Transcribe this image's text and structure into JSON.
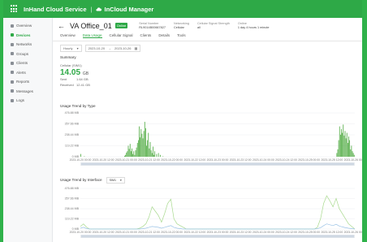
{
  "header": {
    "brand": "InHand Cloud Service",
    "product": "InCloud Manager"
  },
  "sidebar": {
    "items": [
      {
        "label": "Overview",
        "active": false
      },
      {
        "label": "Devices",
        "active": true
      },
      {
        "label": "Networks",
        "active": false
      },
      {
        "label": "Groups",
        "active": false
      },
      {
        "label": "Clients",
        "active": false
      },
      {
        "label": "Alerts",
        "active": false
      },
      {
        "label": "Reports",
        "active": false
      },
      {
        "label": "Messages",
        "active": false
      },
      {
        "label": "Logs",
        "active": false
      }
    ]
  },
  "device": {
    "name": "VA Office_01",
    "status": "Online",
    "meta": [
      {
        "label": "Serial Number",
        "value": "RL9014B00667827"
      },
      {
        "label": "Networking",
        "value": "Cellular"
      },
      {
        "label": "Cellular Signal Strength",
        "value": "all"
      },
      {
        "label": "Online",
        "value": "1 day 4 hours 1 minute"
      }
    ]
  },
  "tabs": [
    "Overview",
    "Data Usage",
    "Cellular Signal",
    "Clients",
    "Details",
    "Tools"
  ],
  "active_tab": "Data Usage",
  "filters": {
    "period": "Hourly",
    "start": "2023-10-20",
    "end": "2023-10-26"
  },
  "summary": {
    "title": "Summary",
    "subtitle": "Cellular (SIM1)",
    "total": "14.05",
    "total_unit": "GB",
    "sent_label": "Sent",
    "sent": "1.64 GB",
    "received_label": "Received",
    "received": "12.41 GB"
  },
  "chart1_title": "Usage Trend by Type",
  "chart2_title": "Usage Trend by Interface",
  "chart2_select": "SIM1",
  "colors": {
    "accent": "#2ea947",
    "bar": "#4aa83c",
    "line": "#a8d98e",
    "line2": "#9bc3e6"
  },
  "chart_data": [
    {
      "type": "bar",
      "title": "Usage Trend by Type",
      "ylabels": [
        "476.88 MB",
        "357.66 MB",
        "238.44 MB",
        "119.22 MB",
        "0 MB"
      ],
      "xlabels": [
        "2023-10-20 00:00",
        "2023-10-20 12:00",
        "2023-10-21 00:00",
        "2023-10-21 12:00",
        "2023-10-22 00:00",
        "2023-10-22 12:00",
        "2023-10-23 00:00",
        "2023-10-23 12:00",
        "2023-10-24 00:00",
        "2023-10-24 12:00",
        "2023-10-25 00:00",
        "2023-10-25 12:00",
        "2023-10-26 00:00"
      ],
      "ylim": [
        0,
        476.88
      ],
      "values": [
        30,
        0,
        0,
        0,
        5,
        0,
        0,
        0,
        0,
        0,
        0,
        0,
        0,
        0,
        0,
        0,
        0,
        0,
        0,
        0,
        0,
        0,
        0,
        0,
        0,
        0,
        0,
        0,
        0,
        0,
        0,
        0,
        0,
        0,
        0,
        0,
        0,
        0,
        0,
        0,
        0,
        0,
        0,
        0,
        0,
        0,
        0,
        0,
        10,
        20,
        45,
        60,
        120,
        85,
        140,
        60,
        90,
        30,
        60,
        20,
        70,
        100,
        150,
        180,
        330,
        210,
        300,
        250,
        200,
        280,
        380,
        310,
        120,
        180,
        260,
        90,
        160,
        70,
        40,
        110,
        20,
        60,
        0,
        30,
        0,
        40,
        0,
        20,
        0,
        0,
        5,
        0,
        0,
        0,
        0,
        0,
        0,
        0,
        0,
        0,
        0,
        0,
        0,
        0,
        0,
        0,
        0,
        0,
        0,
        0,
        0,
        0,
        0,
        0,
        0,
        0,
        0,
        0,
        0,
        0,
        0,
        0,
        0,
        0,
        0,
        0,
        0,
        0,
        0,
        0,
        0,
        0,
        0,
        0,
        0,
        0,
        0,
        0,
        0,
        0,
        0,
        0,
        0,
        0,
        0,
        0,
        0,
        0,
        0,
        0,
        0,
        0,
        0,
        0,
        0,
        0,
        0,
        0,
        0,
        0,
        0,
        0,
        0,
        0,
        0,
        0,
        0,
        0,
        0,
        0,
        0,
        0,
        0,
        0,
        0,
        0,
        0,
        0,
        0,
        0,
        0,
        0,
        0,
        0,
        0,
        0,
        0,
        0,
        0,
        0,
        0,
        0,
        0,
        0,
        0,
        0,
        0,
        0,
        0,
        0,
        0,
        0,
        0,
        0,
        0,
        0,
        0,
        0,
        0,
        0,
        0,
        0,
        0,
        0,
        0,
        0,
        0,
        0,
        0,
        0,
        0,
        0,
        0,
        0,
        0,
        0,
        0,
        0,
        0,
        0,
        0,
        0,
        0,
        0,
        0,
        0,
        0,
        0,
        0,
        0,
        0,
        0,
        0,
        0,
        0,
        0,
        0,
        0,
        0,
        0,
        0,
        0,
        0,
        0,
        0,
        0,
        0,
        0,
        0,
        0,
        0,
        0,
        0,
        0,
        0,
        0,
        0,
        0,
        0,
        0,
        0,
        0,
        0,
        0,
        0,
        0,
        0,
        0,
        0,
        0,
        40,
        80,
        180,
        330,
        240,
        300,
        260,
        350,
        230,
        280,
        200,
        260,
        150,
        220,
        180,
        80,
        120,
        60,
        40,
        20
      ]
    },
    {
      "type": "line",
      "title": "Usage Trend by Interface",
      "ylabels": [
        "476.88 MB",
        "357.66 MB",
        "238.44 MB",
        "119.22 MB",
        "0 MB"
      ],
      "xlabels": [
        "2023-10-20 00:00",
        "2023-10-20 12:00",
        "2023-10-21 00:00",
        "2023-10-21 12:00",
        "2023-10-22 00:00",
        "2023-10-22 12:00",
        "2023-10-23 00:00",
        "2023-10-23 12:00",
        "2023-10-24 00:00",
        "2023-10-24 12:00",
        "2023-10-25 00:00",
        "2023-10-25 12:00",
        "2023-10-26 00:00"
      ],
      "ylim": [
        0,
        476.88
      ],
      "series": [
        {
          "name": "SIM1",
          "values": [
            30,
            60,
            20,
            0,
            0,
            0,
            0,
            0,
            0,
            0,
            0,
            0,
            0,
            0,
            0,
            0,
            0,
            0,
            0,
            10,
            30,
            60,
            140,
            260,
            210,
            160,
            80,
            180,
            300,
            350,
            120,
            60,
            40,
            20,
            0,
            0,
            0,
            0,
            0,
            0,
            0,
            0,
            0,
            0,
            0,
            0,
            0,
            0,
            0,
            0,
            0,
            0,
            0,
            0,
            0,
            0,
            0,
            0,
            0,
            0,
            0,
            0,
            0,
            0,
            0,
            0,
            0,
            0,
            0,
            0,
            0,
            0,
            0,
            0,
            0,
            0,
            20,
            120,
            300,
            390,
            330,
            260,
            360,
            240,
            180,
            120,
            60,
            30,
            0
          ]
        },
        {
          "name": "",
          "values": [
            10,
            20,
            5,
            0,
            0,
            0,
            0,
            0,
            0,
            0,
            0,
            0,
            0,
            0,
            0,
            0,
            0,
            0,
            0,
            0,
            5,
            10,
            20,
            30,
            25,
            20,
            10,
            20,
            30,
            40,
            20,
            10,
            5,
            0,
            0,
            0,
            0,
            0,
            0,
            0,
            0,
            0,
            0,
            0,
            0,
            0,
            0,
            0,
            0,
            0,
            0,
            0,
            0,
            0,
            0,
            0,
            0,
            0,
            0,
            0,
            0,
            0,
            0,
            0,
            0,
            0,
            0,
            0,
            0,
            0,
            0,
            0,
            0,
            0,
            0,
            0,
            5,
            15,
            40,
            60,
            50,
            40,
            55,
            35,
            25,
            15,
            10,
            5,
            0
          ]
        }
      ]
    }
  ]
}
